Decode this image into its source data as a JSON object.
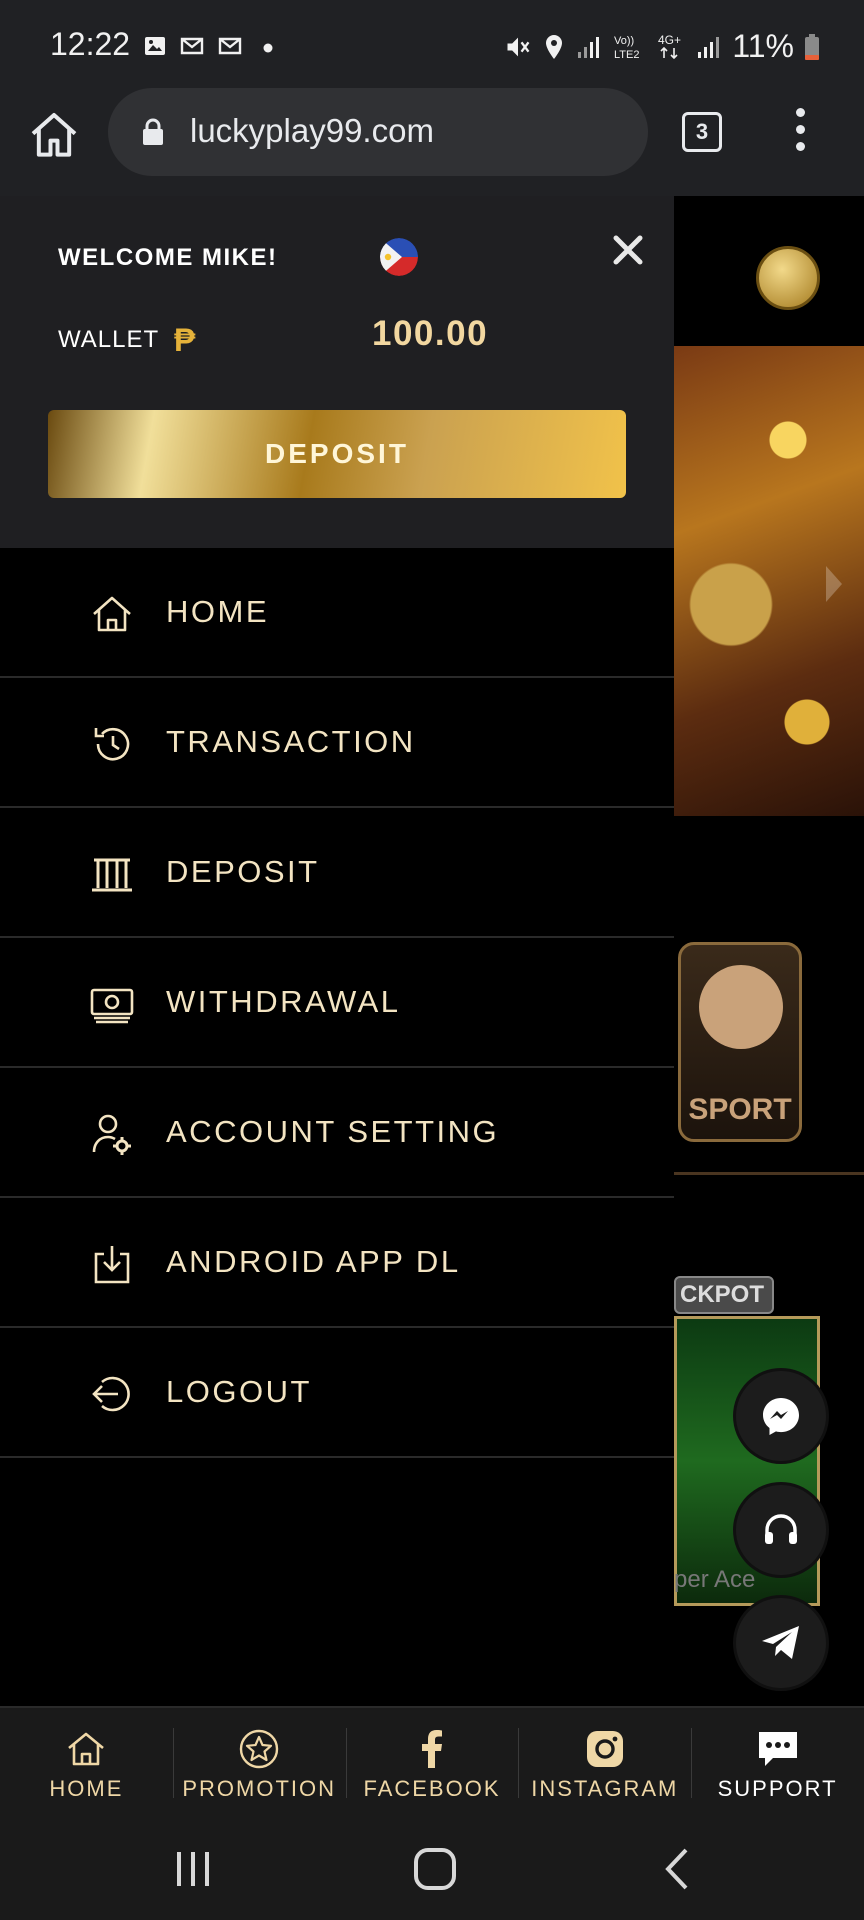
{
  "status_bar": {
    "time": "12:22",
    "battery": "11%",
    "network": "4G+",
    "left_icons": [
      "image-icon",
      "gmail-icon",
      "gmail-icon",
      "dot-icon"
    ],
    "right_icons": [
      "mute-icon",
      "location-icon",
      "signal-icon",
      "volte-icon",
      "signal-icon",
      "battery-icon"
    ]
  },
  "browser": {
    "url": "luckyplay99.com",
    "tab_count": "3"
  },
  "drawer": {
    "welcome": "WELCOME MIKE!",
    "wallet_label": "WALLET",
    "currency_symbol": "₱",
    "balance": "100.00",
    "deposit_button": "DEPOSIT",
    "menu": [
      {
        "label": "HOME",
        "icon": "home-icon"
      },
      {
        "label": "TRANSACTION",
        "icon": "history-icon"
      },
      {
        "label": "DEPOSIT",
        "icon": "bank-icon"
      },
      {
        "label": "WITHDRAWAL",
        "icon": "cash-icon"
      },
      {
        "label": "ACCOUNT SETTING",
        "icon": "user-settings-icon"
      },
      {
        "label": "ANDROID APP DL",
        "icon": "download-icon"
      },
      {
        "label": "LOGOUT",
        "icon": "logout-icon"
      }
    ]
  },
  "background_page": {
    "sport_label": "SPORT",
    "jackpot_label": "CKPOT",
    "game_caption": "per Ace"
  },
  "bottom_nav": [
    {
      "label": "HOME",
      "icon": "home-icon"
    },
    {
      "label": "PROMOTION",
      "icon": "star-icon"
    },
    {
      "label": "FACEBOOK",
      "icon": "facebook-icon"
    },
    {
      "label": "INSTAGRAM",
      "icon": "instagram-icon"
    },
    {
      "label": "SUPPORT",
      "icon": "chat-icon"
    }
  ],
  "colors": {
    "accent_gold": "#e5b23a",
    "menu_text": "#f3e4c2",
    "drawer_header_bg": "#1f1f22"
  }
}
